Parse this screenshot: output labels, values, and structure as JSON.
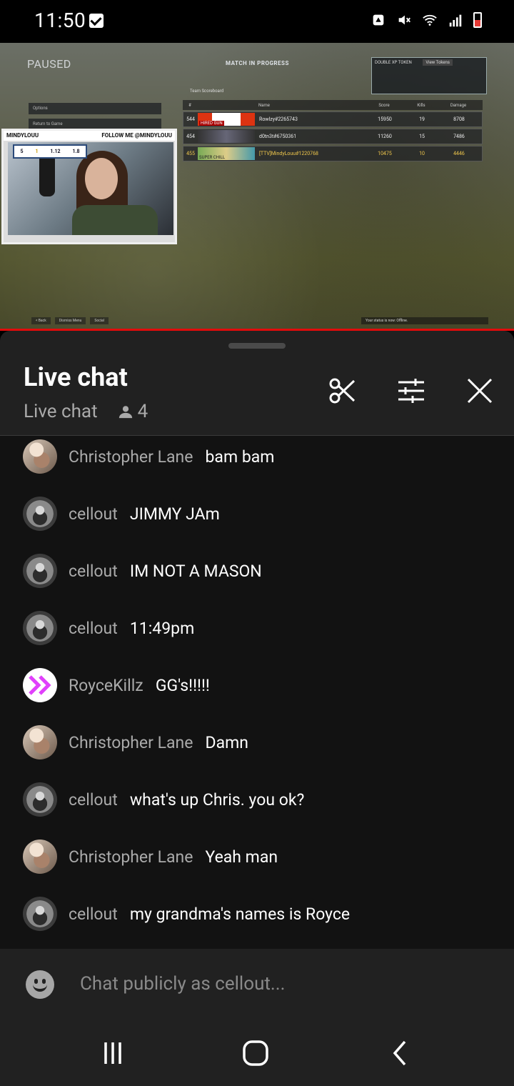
{
  "status_bar": {
    "time": "11:50"
  },
  "video": {
    "paused_label": "PAUSED",
    "match_label": "MATCH IN PROGRESS",
    "xp_token_label": "DOUBLE XP TOKEN",
    "view_tokens": "View Tokens",
    "menu_options": "Options",
    "menu_return": "Return to Game",
    "team_scoreboard": "Team Scoreboard",
    "headers": [
      "#",
      "Name",
      "Score",
      "Kills",
      "Damage"
    ],
    "rows": [
      {
        "rank": "544",
        "banner": "HIRED GUN",
        "name": "Rowlzy#2265743",
        "score": "15950",
        "kills": "19",
        "damage": "8708"
      },
      {
        "rank": "454",
        "banner": "",
        "name": "d0tn3t#6750361",
        "score": "11260",
        "kills": "15",
        "damage": "7486"
      },
      {
        "rank": "455",
        "banner": "SUPER CHILL",
        "name": "[TTV]MindyLouu#1220768",
        "score": "10475",
        "kills": "10",
        "damage": "4446"
      }
    ],
    "webcam_name": "MINDYLOUU",
    "webcam_follow": "FOLLOW ME @MINDYLOUU",
    "webcam_stats": [
      "5",
      "1",
      "1.12",
      "1.8"
    ],
    "bottom_menu": [
      "< Back",
      "Dismiss Menu",
      "Social"
    ],
    "offline_msg": "Your status is now: Offline."
  },
  "chat": {
    "title": "Live chat",
    "subtitle": "Live chat",
    "viewer_count": "4",
    "input_placeholder": "Chat publicly as cellout...",
    "messages": [
      {
        "author": "Christopher Lane",
        "text": "bam bam",
        "avatar": "chris"
      },
      {
        "author": "cellout",
        "text": "JIMMY JAm",
        "avatar": "cell"
      },
      {
        "author": "cellout",
        "text": "IM NOT A MASON",
        "avatar": "cell"
      },
      {
        "author": "cellout",
        "text": "11:49pm",
        "avatar": "cell"
      },
      {
        "author": "RoyceKillz",
        "text": "GG's!!!!!",
        "avatar": "royce"
      },
      {
        "author": "Christopher Lane",
        "text": "Damn",
        "avatar": "chris"
      },
      {
        "author": "cellout",
        "text": "what's up Chris. you ok?",
        "avatar": "cell"
      },
      {
        "author": "Christopher Lane",
        "text": "Yeah man",
        "avatar": "chris"
      },
      {
        "author": "cellout",
        "text": "my grandma's names is Royce",
        "avatar": "cell"
      }
    ]
  },
  "colors": {
    "panel_bg": "#212121",
    "messages_bg": "#121212",
    "progress_red": "#e20b0b"
  }
}
